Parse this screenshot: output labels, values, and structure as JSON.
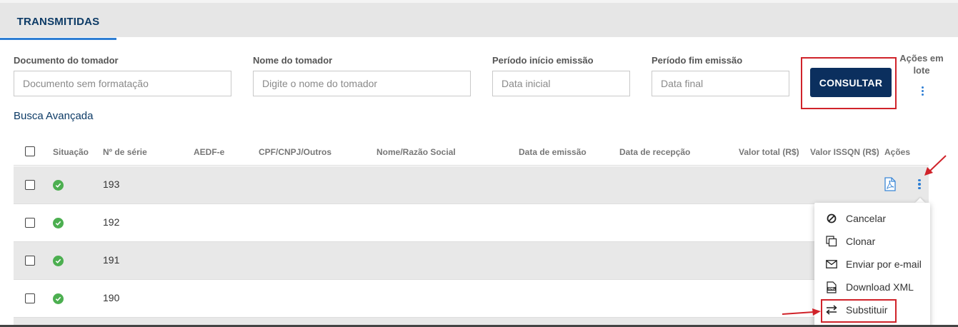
{
  "tabs": [
    {
      "label": "TRANSMITIDAS",
      "active": true
    }
  ],
  "filters": {
    "documento": {
      "label": "Documento do tomador",
      "placeholder": "Documento sem formatação"
    },
    "nome": {
      "label": "Nome do tomador",
      "placeholder": "Digite o nome do tomador"
    },
    "inicio": {
      "label": "Período início emissão",
      "placeholder": "Data inicial"
    },
    "fim": {
      "label": "Período fim emissão",
      "placeholder": "Data final"
    },
    "consultar_label": "CONSULTAR",
    "acoes_lote_label_1": "Ações em",
    "acoes_lote_label_2": "lote",
    "busca_avancada": "Busca Avançada"
  },
  "table": {
    "headers": {
      "situacao": "Situação",
      "serie": "Nº de série",
      "aedf": "AEDF-e",
      "cpf": "CPF/CNPJ/Outros",
      "nome": "Nome/Razão Social",
      "emissao": "Data de emissão",
      "recepcao": "Data de recepção",
      "valor_total": "Valor total (R$)",
      "valor_issqn": "Valor ISSQN (R$)",
      "acoes": "Ações"
    },
    "rows": [
      {
        "serie": "193"
      },
      {
        "serie": "192"
      },
      {
        "serie": "191"
      },
      {
        "serie": "190"
      }
    ]
  },
  "menu": {
    "items": [
      {
        "label": "Cancelar",
        "icon": "ban-icon"
      },
      {
        "label": "Clonar",
        "icon": "copy-icon"
      },
      {
        "label": "Enviar por e-mail",
        "icon": "envelope-icon"
      },
      {
        "label": "Download XML",
        "icon": "xml-file-icon"
      },
      {
        "label": "Substituir",
        "icon": "swap-arrows-icon"
      }
    ]
  },
  "colors": {
    "accent": "#2f7fd4",
    "primary": "#0b2f5e",
    "highlight": "#d0232a",
    "success": "#4caf50"
  }
}
